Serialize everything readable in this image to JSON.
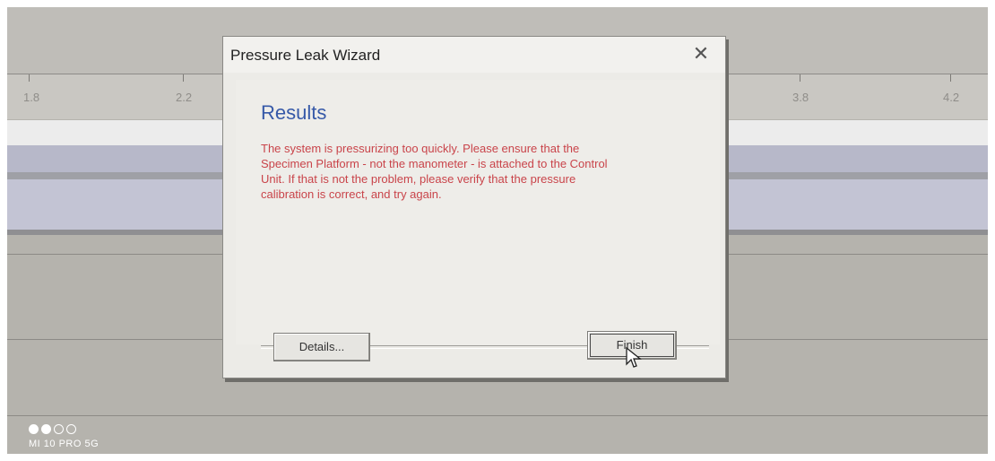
{
  "ruler": {
    "labels": [
      "1.8",
      "2.2",
      "3.8",
      "4.2"
    ]
  },
  "dialog": {
    "title": "Pressure Leak Wizard",
    "close_symbol": "✕",
    "heading": "Results",
    "message": "The system is pressurizing too quickly. Please ensure that the\nSpecimen Platform - not the manometer - is attached to the Control\nUnit. If that is not the problem, please verify that the pressure\ncalibration is correct, and try again.",
    "buttons": {
      "details": "Details...",
      "finish": "Finish"
    },
    "colors": {
      "heading": "#3659a8",
      "message": "#c9444a"
    }
  },
  "watermark": {
    "device": "MI 10 PRO 5G"
  }
}
